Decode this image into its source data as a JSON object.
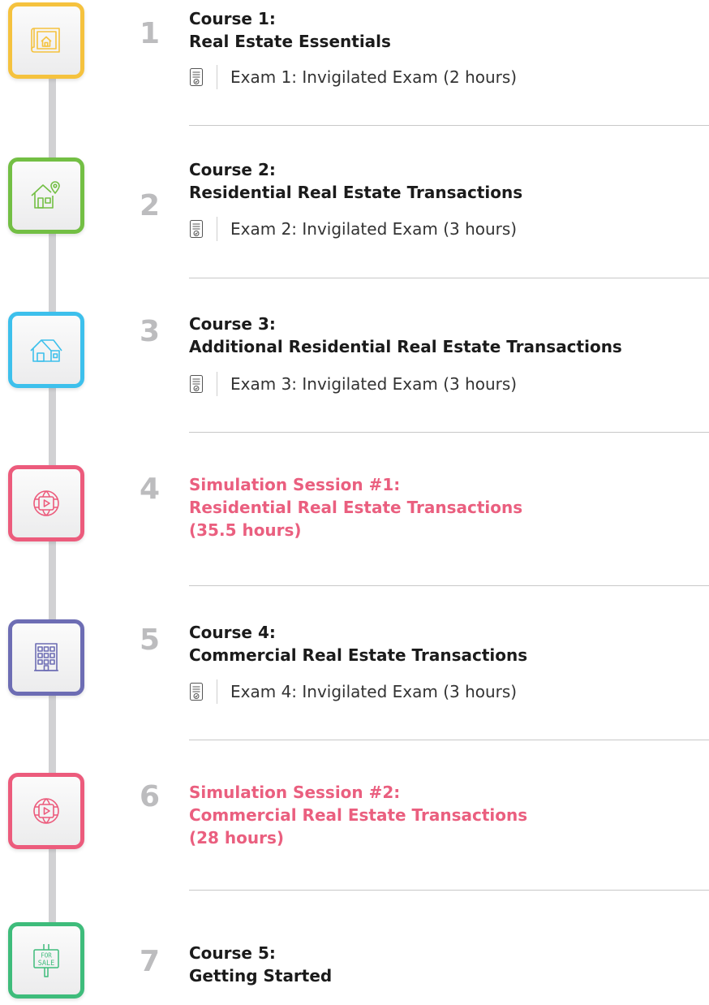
{
  "steps": [
    {
      "number": "1",
      "icon": "blueprint-house-icon",
      "color": "#f5c23e",
      "title_line1": "Course 1:",
      "title_line2": "Real Estate Essentials",
      "exam": "Exam 1: Invigilated Exam (2 hours)"
    },
    {
      "number": "2",
      "icon": "house-location-pin-icon",
      "color": "#73bf44",
      "title_line1": "Course 2:",
      "title_line2": "Residential Real Estate Transactions",
      "exam": "Exam 2: Invigilated Exam (3 hours)"
    },
    {
      "number": "3",
      "icon": "house-icon",
      "color": "#3dc0ec",
      "title_line1": "Course 3:",
      "title_line2": "Additional Residential Real Estate Transactions",
      "exam": "Exam 3: Invigilated Exam (3 hours)"
    },
    {
      "number": "4",
      "icon": "video-globe-icon",
      "color": "#ec5b7c",
      "title_line1": "Simulation Session #1:",
      "title_line2": "Residential Real Estate Transactions",
      "title_line3": "(35.5 hours)"
    },
    {
      "number": "5",
      "icon": "office-building-icon",
      "color": "#6d6db4",
      "title_line1": "Course 4:",
      "title_line2": "Commercial Real Estate Transactions",
      "exam": "Exam 4: Invigilated Exam (3 hours)"
    },
    {
      "number": "6",
      "icon": "video-globe-icon",
      "color": "#ec5b7c",
      "title_line1": "Simulation Session #2:",
      "title_line2": "Commercial Real Estate Transactions",
      "title_line3": "(28  hours)"
    },
    {
      "number": "7",
      "icon": "for-sale-sign-icon",
      "color": "#3ebc7b",
      "title_line1": "Course 5:",
      "title_line2": "Getting Started",
      "sign_text_1": "FOR",
      "sign_text_2": "SALE"
    }
  ],
  "exam_icon": "exam-checklist-icon",
  "colors": {
    "title": "#1b1b1b",
    "simulation_title": "#ea5f7f",
    "step_number": "#bcbcbe",
    "timeline": "#d1d1d3"
  }
}
